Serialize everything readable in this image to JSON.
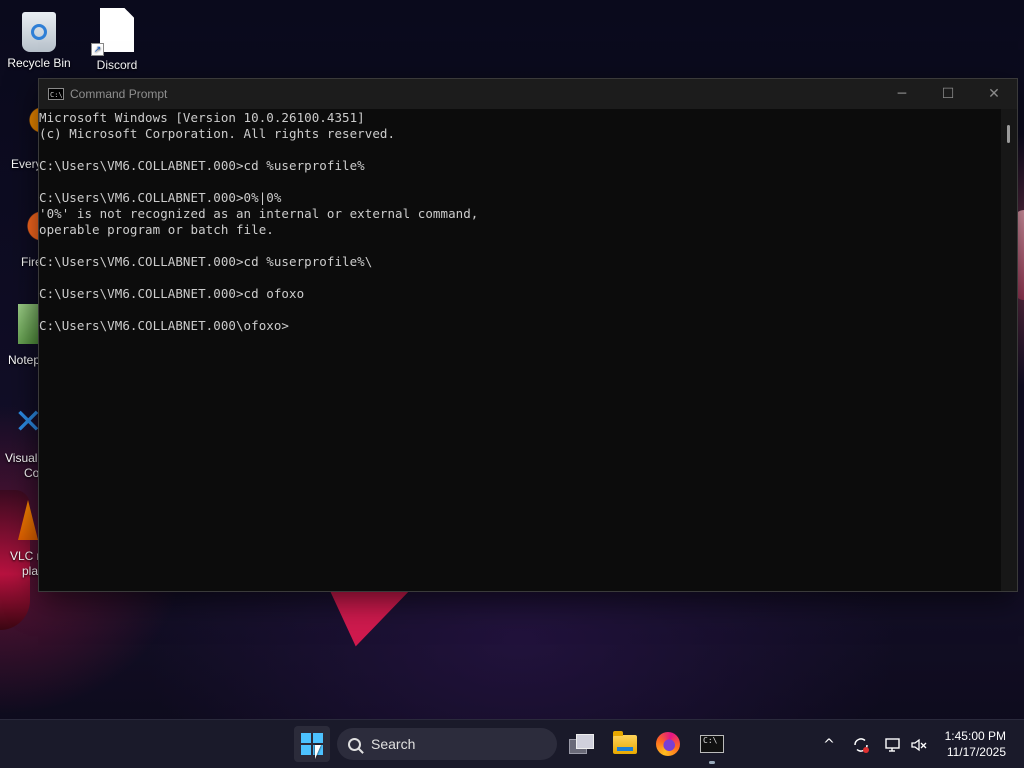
{
  "desktop": {
    "icons": [
      {
        "label": "Recycle Bin"
      },
      {
        "label": "Discord"
      }
    ],
    "partial_icons": [
      {
        "label": "Every"
      },
      {
        "label": "Fire"
      },
      {
        "label": "Notep"
      },
      {
        "label_line1": "Visual",
        "label_line2": "Co"
      },
      {
        "label_line1": "VLC m",
        "label_line2": "pla"
      }
    ]
  },
  "console": {
    "title": "Command Prompt",
    "minimize": "─",
    "maximize": "☐",
    "close": "✕",
    "lines": [
      "Microsoft Windows [Version 10.0.26100.4351]",
      "(c) Microsoft Corporation. All rights reserved.",
      "",
      "C:\\Users\\VM6.COLLABNET.000>cd %userprofile%",
      "",
      "C:\\Users\\VM6.COLLABNET.000>0%|0%",
      "'0%' is not recognized as an internal or external command,",
      "operable program or batch file.",
      "",
      "C:\\Users\\VM6.COLLABNET.000>cd %userprofile%\\",
      "",
      "C:\\Users\\VM6.COLLABNET.000>cd ofoxo",
      "",
      "C:\\Users\\VM6.COLLABNET.000\\ofoxo>"
    ]
  },
  "taskbar": {
    "search_placeholder": "Search",
    "tray": {
      "chevron": "^",
      "time": "1:45:00 PM",
      "date": "11/17/2025"
    }
  },
  "colors": {
    "accent": "#4cc2ff",
    "console_bg": "#0c0c0c",
    "console_text": "#cccccc",
    "taskbar_bg": "#1a1a2a"
  }
}
